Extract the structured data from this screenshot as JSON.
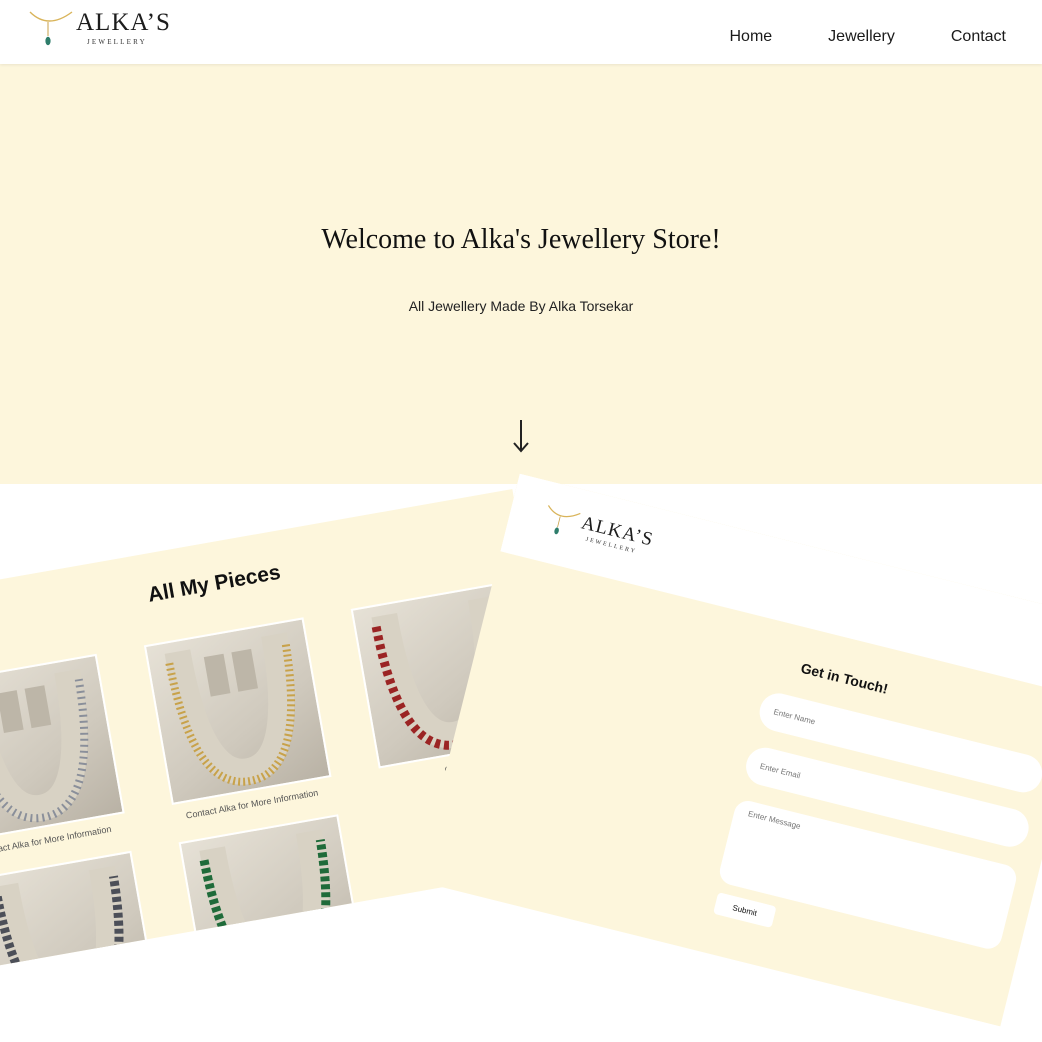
{
  "brand": {
    "name": "ALKA’S",
    "subtitle": "JEWELLERY"
  },
  "nav": {
    "items": [
      "Home",
      "Jewellery",
      "Contact"
    ]
  },
  "hero": {
    "title": "Welcome to Alka's Jewellery Store!",
    "subtitle": "All Jewellery Made By Alka Torsekar",
    "arrow": "↓"
  },
  "gallery": {
    "title": "All My Pieces",
    "caption": "Contact Alka for More Information",
    "caption_short": "Contac",
    "pieces": [
      {
        "bead_color": "#8a8f9a"
      },
      {
        "bead_color": "#c8a24a"
      },
      {
        "bead_color": "#9b2424"
      },
      {
        "bead_color": "#4c4f58"
      },
      {
        "bead_color": "#1f6b3a"
      }
    ]
  },
  "contact": {
    "title": "Get in Touch!",
    "name_placeholder": "Enter Name",
    "email_placeholder": "Enter Email",
    "message_placeholder": "Enter Message",
    "submit_label": "Submit"
  },
  "colors": {
    "cream": "#fdf6dc",
    "logo_gold": "#d9b45a",
    "logo_gem": "#2e7d6b"
  }
}
